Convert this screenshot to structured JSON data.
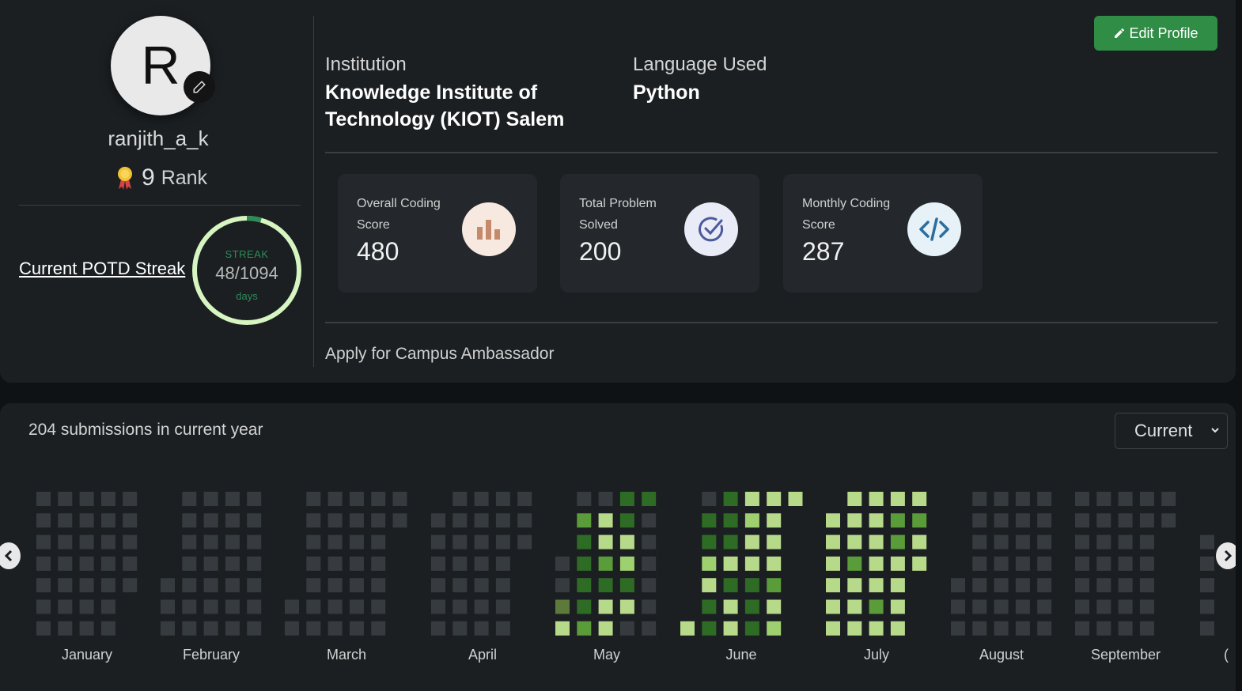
{
  "profile": {
    "avatar_letter": "R",
    "username": "ranjith_a_k",
    "rank_number": "9",
    "rank_label": "Rank",
    "potd_link": "Current POTD Streak",
    "streak": {
      "label": "STREAK",
      "value": "48/1094",
      "days": "days",
      "current": 48,
      "max": 1094
    }
  },
  "info": {
    "institution_label": "Institution",
    "institution_line1": "Knowledge Institute of",
    "institution_line2": "Technology (KIOT) Salem",
    "language_label": "Language Used",
    "language_value": "Python",
    "edit_label": "Edit Profile"
  },
  "stats": [
    {
      "line1": "Overall Coding",
      "line2": "Score",
      "value": "480",
      "icon": "bar-chart-icon",
      "icon_bg": "#f7e9e0",
      "icon_color": "#c48a6a"
    },
    {
      "line1": "Total Problem",
      "line2": "Solved",
      "value": "200",
      "icon": "check-circle-icon",
      "icon_bg": "#e9ebf7",
      "icon_color": "#4a5a9a"
    },
    {
      "line1": "Monthly Coding",
      "line2": "Score",
      "value": "287",
      "icon": "code-icon",
      "icon_bg": "#e6f1f8",
      "icon_color": "#2b6e9e"
    }
  ],
  "campus_link": "Apply for Campus Ambassador",
  "submissions": {
    "text": "204 submissions in current year",
    "year_selected": "Current",
    "months": [
      "January",
      "February",
      "March",
      "April",
      "May",
      "June",
      "July",
      "August",
      "September",
      "("
    ],
    "colors": {
      "empty": "#363b40",
      "l1": "#5e7a3a",
      "l2": "#2e6b24",
      "l3": "#5a9b3a",
      "l4": "#9fd070",
      "l5": "#b7d98a"
    }
  }
}
